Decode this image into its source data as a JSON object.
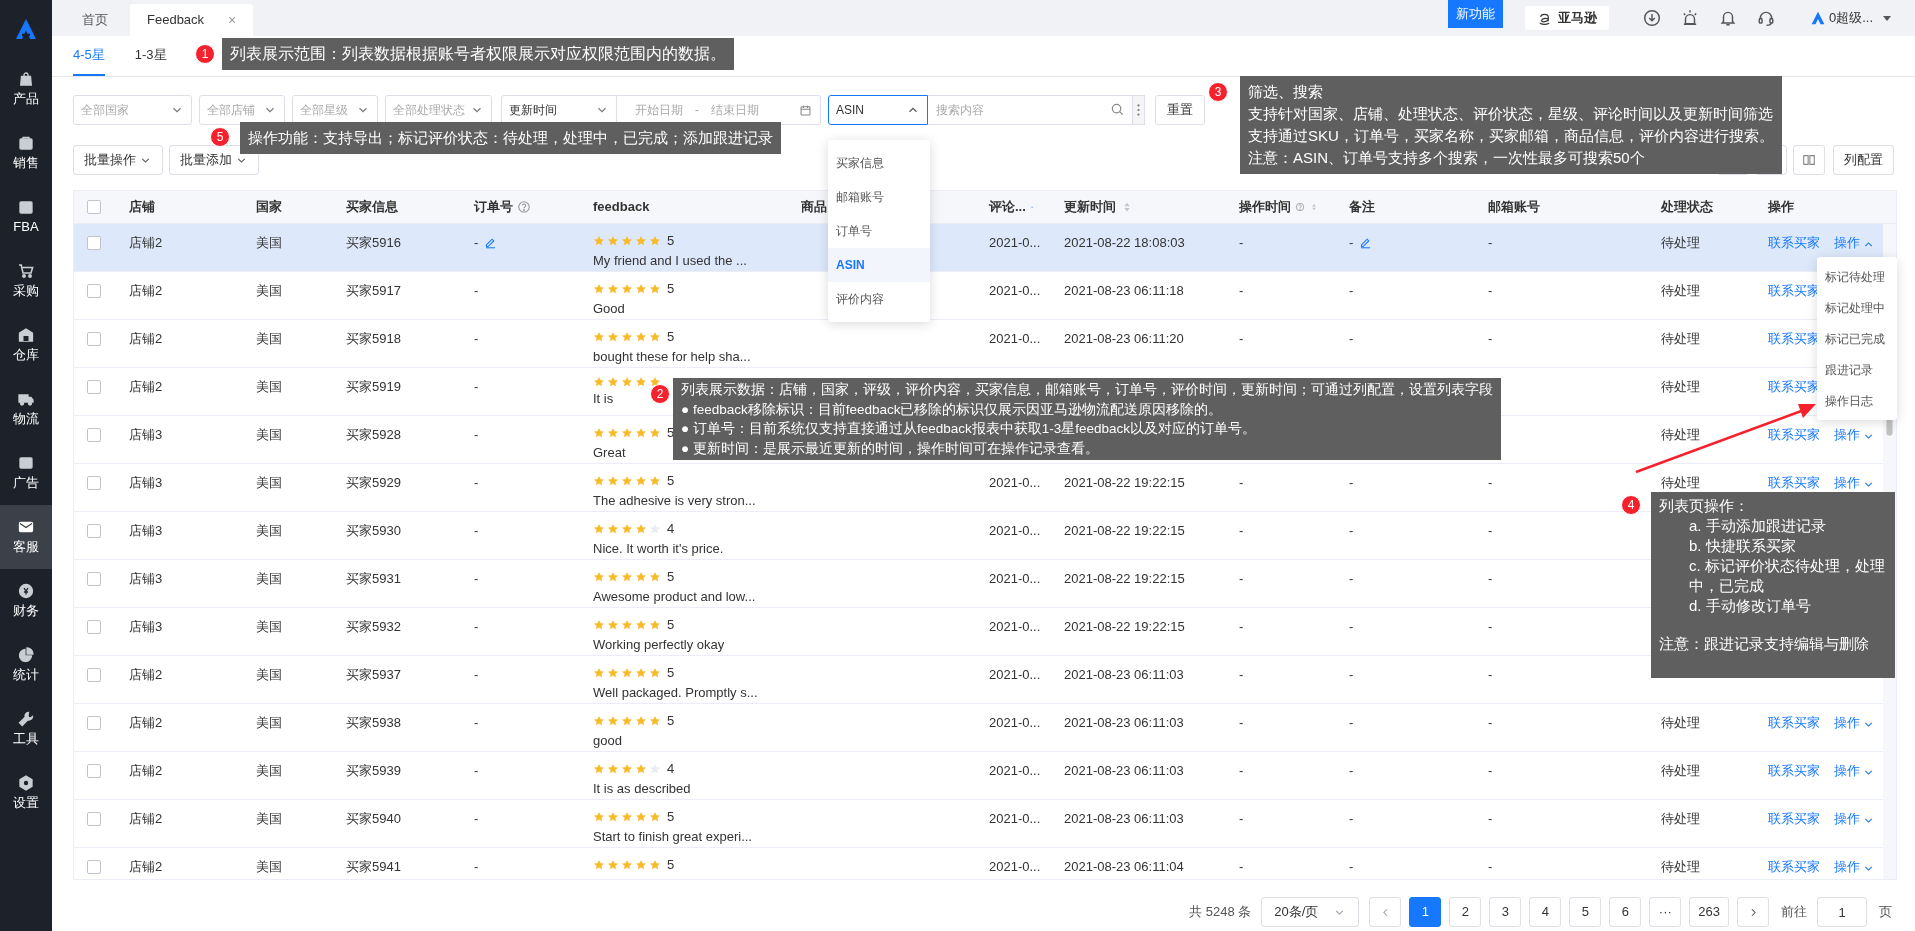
{
  "sidebar": {
    "items": [
      {
        "label": "产品",
        "selected": false
      },
      {
        "label": "销售",
        "selected": false
      },
      {
        "label": "FBA",
        "selected": false
      },
      {
        "label": "采购",
        "selected": false
      },
      {
        "label": "仓库",
        "selected": false
      },
      {
        "label": "物流",
        "selected": false
      },
      {
        "label": "广告",
        "selected": false
      },
      {
        "label": "客服",
        "selected": true
      },
      {
        "label": "财务",
        "selected": false
      },
      {
        "label": "统计",
        "selected": false
      },
      {
        "label": "工具",
        "selected": false
      },
      {
        "label": "设置",
        "selected": false
      }
    ]
  },
  "tabs": [
    {
      "label": "首页",
      "selected": false
    },
    {
      "label": "Feedback",
      "selected": true,
      "close": "×"
    }
  ],
  "header": {
    "new_feature": "新功能",
    "marketplace": "亚马逊",
    "user": "0超级..."
  },
  "star_tabs": [
    {
      "label": "4-5星",
      "selected": true
    },
    {
      "label": "1-3星",
      "selected": false
    }
  ],
  "filters": {
    "selects": [
      "全部国家",
      "全部店铺",
      "全部星级",
      "全部处理状态"
    ],
    "time_field": "更新时间",
    "start_placeholder": "开始日期",
    "range_separator": "-",
    "end_placeholder": "结束日期",
    "search_type": "ASIN",
    "search_placeholder": "搜索内容",
    "reset": "重置"
  },
  "search_type_menu": [
    {
      "label": "买家信息",
      "selected": false
    },
    {
      "label": "邮箱账号",
      "selected": false
    },
    {
      "label": "订单号",
      "selected": false
    },
    {
      "label": "ASIN",
      "selected": true
    },
    {
      "label": "评价内容",
      "selected": false
    }
  ],
  "actions": [
    "批量操作",
    "批量添加"
  ],
  "column_config": "列配置",
  "table": {
    "all_checked": false,
    "columns": [
      {
        "label": "店铺",
        "help": false
      },
      {
        "label": "国家",
        "help": false
      },
      {
        "label": "买家信息",
        "help": false
      },
      {
        "label": "订单号",
        "help": true
      },
      {
        "label": "feedback",
        "help": false
      },
      {
        "label": "商品",
        "help": false
      },
      {
        "label": "评论...",
        "help": false,
        "sorted": true
      },
      {
        "label": "更新时间",
        "help": false,
        "sorted": false
      },
      {
        "label": "操作时间",
        "help": true,
        "sorted": false
      },
      {
        "label": "备注",
        "help": false
      },
      {
        "label": "邮箱账号",
        "help": false
      },
      {
        "label": "处理状态",
        "help": false
      },
      {
        "label": "操作",
        "help": false
      }
    ],
    "rows": [
      {
        "checked": false,
        "highlighted": true,
        "shop": "店铺2",
        "country": "美国",
        "buyer": "买家5916",
        "order": "-",
        "order_edit": true,
        "stars": 5,
        "rating": "5",
        "feedback": "My friend and I used the ...",
        "review_time": "2021-0...",
        "update_time": "2021-08-22 18:08:03",
        "op_time": "-",
        "remark": "-",
        "remark_edit": true,
        "email": "-",
        "status": "待处理",
        "contact": "联系买家",
        "action": "操作",
        "action_open": true
      },
      {
        "checked": false,
        "highlighted": false,
        "shop": "店铺2",
        "country": "美国",
        "buyer": "买家5917",
        "order": "-",
        "order_edit": false,
        "stars": 5,
        "rating": "5",
        "feedback": "Good",
        "review_time": "2021-0...",
        "update_time": "2021-08-23 06:11:18",
        "op_time": "-",
        "remark": "-",
        "remark_edit": false,
        "email": "-",
        "status": "待处理",
        "contact": "联系买家"
      },
      {
        "checked": false,
        "highlighted": false,
        "shop": "店铺2",
        "country": "美国",
        "buyer": "买家5918",
        "order": "-",
        "order_edit": false,
        "stars": 5,
        "rating": "5",
        "feedback": "bought these for help sha...",
        "review_time": "2021-0...",
        "update_time": "2021-08-23 06:11:20",
        "op_time": "-",
        "remark": "-",
        "remark_edit": false,
        "email": "-",
        "status": "待处理",
        "contact": "联系买家"
      },
      {
        "checked": false,
        "highlighted": false,
        "shop": "店铺2",
        "country": "美国",
        "buyer": "买家5919",
        "order": "-",
        "order_edit": false,
        "stars": 5,
        "feedback": "It is",
        "remark_edit": false,
        "status": "待处理",
        "contact": "联系买家"
      },
      {
        "checked": false,
        "highlighted": false,
        "shop": "店铺3",
        "country": "美国",
        "buyer": "买家5928",
        "order": "-",
        "order_edit": false,
        "stars": 5,
        "rating": "5",
        "feedback": "Great",
        "remark_edit": false,
        "status": "待处理",
        "contact": "联系买家",
        "action": "操作",
        "action_open": false
      },
      {
        "checked": false,
        "highlighted": false,
        "shop": "店铺3",
        "country": "美国",
        "buyer": "买家5929",
        "order": "-",
        "order_edit": false,
        "stars": 5,
        "rating": "5",
        "feedback": "The adhesive is very stron...",
        "review_time": "2021-0...",
        "update_time": "2021-08-22 19:22:15",
        "op_time": "-",
        "remark": "-",
        "remark_edit": false,
        "email": "-",
        "status": "待处理",
        "contact": "联系买家",
        "action": "操作",
        "action_open": false
      },
      {
        "checked": false,
        "highlighted": false,
        "shop": "店铺3",
        "country": "美国",
        "buyer": "买家5930",
        "order": "-",
        "order_edit": false,
        "stars": 4,
        "rating": "4",
        "feedback": "Nice. It worth it's price.",
        "review_time": "2021-0...",
        "update_time": "2021-08-22 19:22:15",
        "op_time": "-",
        "remark": "-",
        "remark_edit": false,
        "email": "-"
      },
      {
        "checked": false,
        "highlighted": false,
        "shop": "店铺3",
        "country": "美国",
        "buyer": "买家5931",
        "order": "-",
        "order_edit": false,
        "stars": 5,
        "rating": "5",
        "feedback": "Awesome product and low...",
        "review_time": "2021-0...",
        "update_time": "2021-08-22 19:22:15",
        "op_time": "-",
        "remark": "-",
        "remark_edit": false,
        "email": "-"
      },
      {
        "checked": false,
        "highlighted": false,
        "shop": "店铺3",
        "country": "美国",
        "buyer": "买家5932",
        "order": "-",
        "order_edit": false,
        "stars": 5,
        "rating": "5",
        "feedback": "Working perfectly okay",
        "review_time": "2021-0...",
        "update_time": "2021-08-22 19:22:15",
        "op_time": "-",
        "remark": "-",
        "remark_edit": false,
        "email": "-"
      },
      {
        "checked": false,
        "highlighted": false,
        "shop": "店铺2",
        "country": "美国",
        "buyer": "买家5937",
        "order": "-",
        "order_edit": false,
        "stars": 5,
        "rating": "5",
        "feedback": "Well packaged. Promptly s...",
        "review_time": "2021-0...",
        "update_time": "2021-08-23 06:11:03",
        "op_time": "-",
        "remark": "-",
        "remark_edit": false,
        "email": "-"
      },
      {
        "checked": false,
        "highlighted": false,
        "shop": "店铺2",
        "country": "美国",
        "buyer": "买家5938",
        "order": "-",
        "order_edit": false,
        "stars": 5,
        "rating": "5",
        "feedback": "good",
        "review_time": "2021-0...",
        "update_time": "2021-08-23 06:11:03",
        "op_time": "-",
        "remark": "-",
        "remark_edit": false,
        "email": "-",
        "status": "待处理",
        "contact": "联系买家",
        "action": "操作",
        "action_open": false
      },
      {
        "checked": false,
        "highlighted": false,
        "shop": "店铺2",
        "country": "美国",
        "buyer": "买家5939",
        "order": "-",
        "order_edit": false,
        "stars": 4,
        "rating": "4",
        "feedback": "It is as described",
        "review_time": "2021-0...",
        "update_time": "2021-08-23 06:11:03",
        "op_time": "-",
        "remark": "-",
        "remark_edit": false,
        "email": "-",
        "status": "待处理",
        "contact": "联系买家",
        "action": "操作",
        "action_open": false
      },
      {
        "checked": false,
        "highlighted": false,
        "shop": "店铺2",
        "country": "美国",
        "buyer": "买家5940",
        "order": "-",
        "order_edit": false,
        "stars": 5,
        "rating": "5",
        "feedback": "Start to finish great experi...",
        "review_time": "2021-0...",
        "update_time": "2021-08-23 06:11:03",
        "op_time": "-",
        "remark": "-",
        "remark_edit": false,
        "email": "-",
        "status": "待处理",
        "contact": "联系买家",
        "action": "操作",
        "action_open": false
      },
      {
        "checked": false,
        "highlighted": false,
        "shop": "店铺2",
        "country": "美国",
        "buyer": "买家5941",
        "order": "-",
        "order_edit": false,
        "stars": 5,
        "rating": "5",
        "review_time": "2021-0...",
        "update_time": "2021-08-23 06:11:04",
        "op_time": "-",
        "remark": "-",
        "remark_edit": false,
        "email": "-",
        "status": "待处理",
        "contact": "联系买家",
        "action": "操作",
        "action_open": false
      }
    ]
  },
  "row_menu": [
    "标记待处理",
    "标记处理中",
    "标记已完成",
    "跟进记录",
    "操作日志"
  ],
  "pagination": {
    "total": "共 5248 条",
    "page_size": "20条/页",
    "pages": [
      {
        "label": "1",
        "selected": true
      },
      {
        "label": "2",
        "selected": false
      },
      {
        "label": "3",
        "selected": false
      },
      {
        "label": "4",
        "selected": false
      },
      {
        "label": "5",
        "selected": false
      },
      {
        "label": "6",
        "selected": false
      },
      {
        "label": "···",
        "selected": false
      },
      {
        "label": "263",
        "selected": false
      }
    ],
    "goto_label": "前往",
    "goto_value": "1",
    "page_suffix": "页"
  },
  "annotations": [
    {
      "number": "1",
      "lines": [
        {
          "kind": "plain",
          "text": "列表展示范围：列表数据根据账号者权限展示对应权限范围内的数据。"
        }
      ]
    },
    {
      "number": "2",
      "lines": [
        {
          "kind": "plain",
          "text": "列表展示数据：店铺，国家，评级，评价内容，买家信息，邮箱账号，订单号，评价时间，更新时间；可通过列配置，设置列表字段"
        },
        {
          "kind": "plain",
          "text": "● feedback移除标识：目前feedback已移除的标识仅展示因亚马逊物流配送原因移除的。"
        },
        {
          "kind": "plain",
          "text": "● 订单号：目前系统仅支持直接通过从feedback报表中获取1-3星feedback以及对应的订单号。"
        },
        {
          "kind": "plain",
          "text": "● 更新时间：是展示最近更新的时间，操作时间可在操作记录查看。"
        }
      ]
    },
    {
      "number": "3",
      "lines": [
        {
          "kind": "plain",
          "text": "筛选、搜索"
        },
        {
          "kind": "plain",
          "text": "支持针对国家、店铺、处理状态、评价状态，星级、评论时间以及更新时间筛选"
        },
        {
          "kind": "plain",
          "text": "支持通过SKU，订单号，买家名称，买家邮箱，商品信息，评价内容进行搜索。"
        },
        {
          "kind": "plain",
          "text": "注意：ASIN、订单号支持多个搜索，一次性最多可搜索50个"
        }
      ]
    },
    {
      "number": "4",
      "lines": [
        {
          "kind": "plain",
          "text": "列表页操作："
        },
        {
          "kind": "item",
          "text": "a. 手动添加跟进记录"
        },
        {
          "kind": "item",
          "text": "b. 快捷联系买家"
        },
        {
          "kind": "item",
          "text": "c. 标记评价状态待处理，处理中，已完成"
        },
        {
          "kind": "item",
          "text": "d. 手动修改订单号"
        },
        {
          "kind": "note",
          "text": "注意：跟进记录支持编辑与删除"
        }
      ]
    },
    {
      "number": "5",
      "lines": [
        {
          "kind": "plain",
          "text": "操作功能：支持导出；标记评价状态：待处理，处理中，已完成；添加跟进记录"
        }
      ]
    }
  ]
}
